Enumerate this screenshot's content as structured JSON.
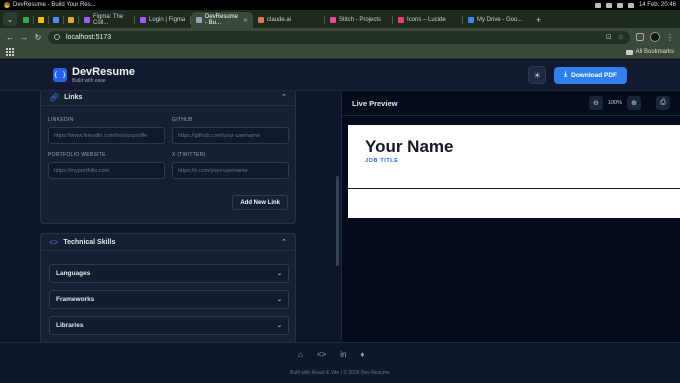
{
  "os": {
    "app_title": "DevResume - Build Your Res...",
    "clock": "14 Feb, 20:46"
  },
  "browser": {
    "tabs": [
      {
        "label": ""
      },
      {
        "label": ""
      },
      {
        "label": ""
      },
      {
        "label": ""
      },
      {
        "label": "Figma: The Coll..."
      },
      {
        "label": "Login | Figma"
      },
      {
        "label": "DevResume - Bu..."
      },
      {
        "label": "claude.ai"
      },
      {
        "label": "Stitch - Projects"
      },
      {
        "label": "Icons – Lucide"
      },
      {
        "label": "My Drive - Goo..."
      }
    ],
    "url": "localhost:5173",
    "bookmarks_label": "All Bookmarks"
  },
  "app": {
    "brand_icon": "{ }",
    "title": "DevResume",
    "tagline": "Build with ease",
    "download_label": "Download PDF"
  },
  "editor": {
    "links": {
      "title": "Links",
      "linkedin_label": "LINKEDIN",
      "linkedin_placeholder": "https://www.linkedin.com/in/yourprofile",
      "github_label": "GITHUB",
      "github_placeholder": "https://github.com/your-username",
      "portfolio_label": "PORTFOLIO WEBSITE",
      "portfolio_placeholder": "https://myportfolio.com",
      "twitter_label": "X (TWITTER)",
      "twitter_placeholder": "https://x.com/your-username",
      "add_link_label": "Add New Link"
    },
    "skills": {
      "title": "Technical Skills",
      "groups": [
        "Languages",
        "Frameworks",
        "Libraries"
      ]
    }
  },
  "preview": {
    "title": "Live Preview",
    "zoom": "100%",
    "resume_name": "Your Name",
    "resume_job": "JOB TITLE"
  },
  "footer": {
    "copyright": "Built with React & Vite | © 2026 Dev Resume"
  }
}
